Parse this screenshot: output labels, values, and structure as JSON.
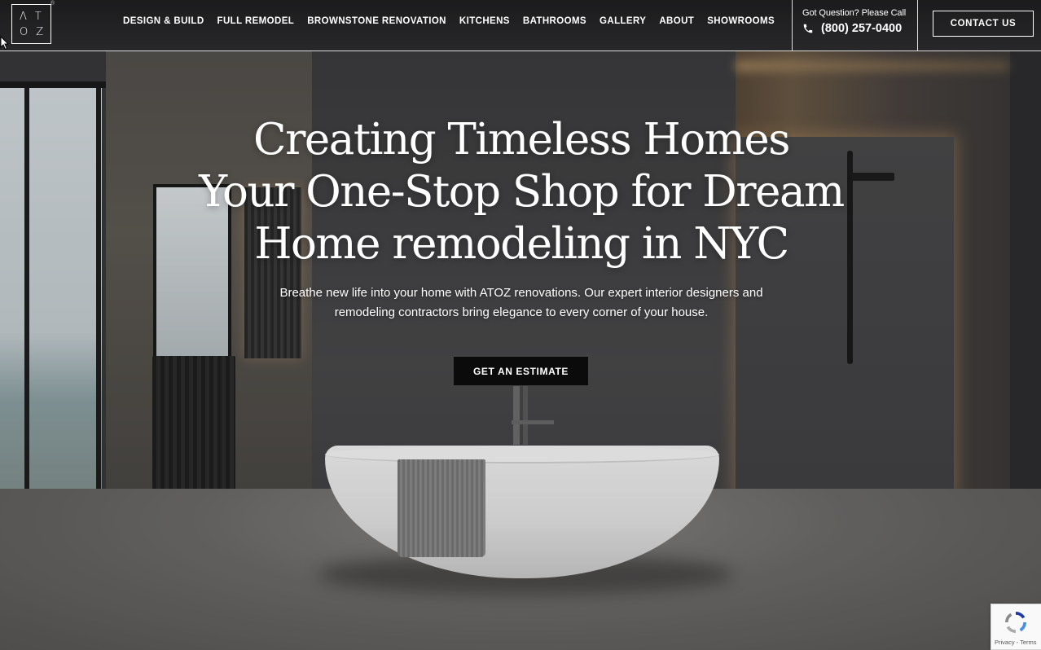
{
  "brand": {
    "logo_top": "ΛT",
    "logo_bottom": "OZ",
    "registered": "®"
  },
  "nav": {
    "items": [
      {
        "label": "DESIGN & BUILD"
      },
      {
        "label": "FULL REMODEL"
      },
      {
        "label": "BROWNSTONE RENOVATION"
      },
      {
        "label": "KITCHENS"
      },
      {
        "label": "BATHROOMS"
      },
      {
        "label": "GALLERY"
      },
      {
        "label": "ABOUT"
      },
      {
        "label": "SHOWROOMS"
      }
    ]
  },
  "contact": {
    "question": "Got Question? Please Call",
    "phone": "(800) 257-0400",
    "button_label": "CONTACT US"
  },
  "hero": {
    "title_line1": "Creating Timeless Homes",
    "title_line2": "Your One-Stop Shop for Dream",
    "title_line3": "Home remodeling in NYC",
    "subtitle_line1": "Breathe new life into your home with ATOZ renovations. Our expert interior designers and",
    "subtitle_line2": "remodeling contractors bring elegance to every corner of your house.",
    "cta_label": "GET AN ESTIMATE"
  },
  "recaptcha": {
    "links": "Privacy - Terms"
  },
  "colors": {
    "header_text": "#ffffff",
    "cta_background": "#0b0b0b",
    "accent_glow": "#a88a62"
  },
  "icons": {
    "phone": "phone-icon",
    "recaptcha": "recaptcha-icon",
    "cursor": "mouse-cursor-icon"
  }
}
